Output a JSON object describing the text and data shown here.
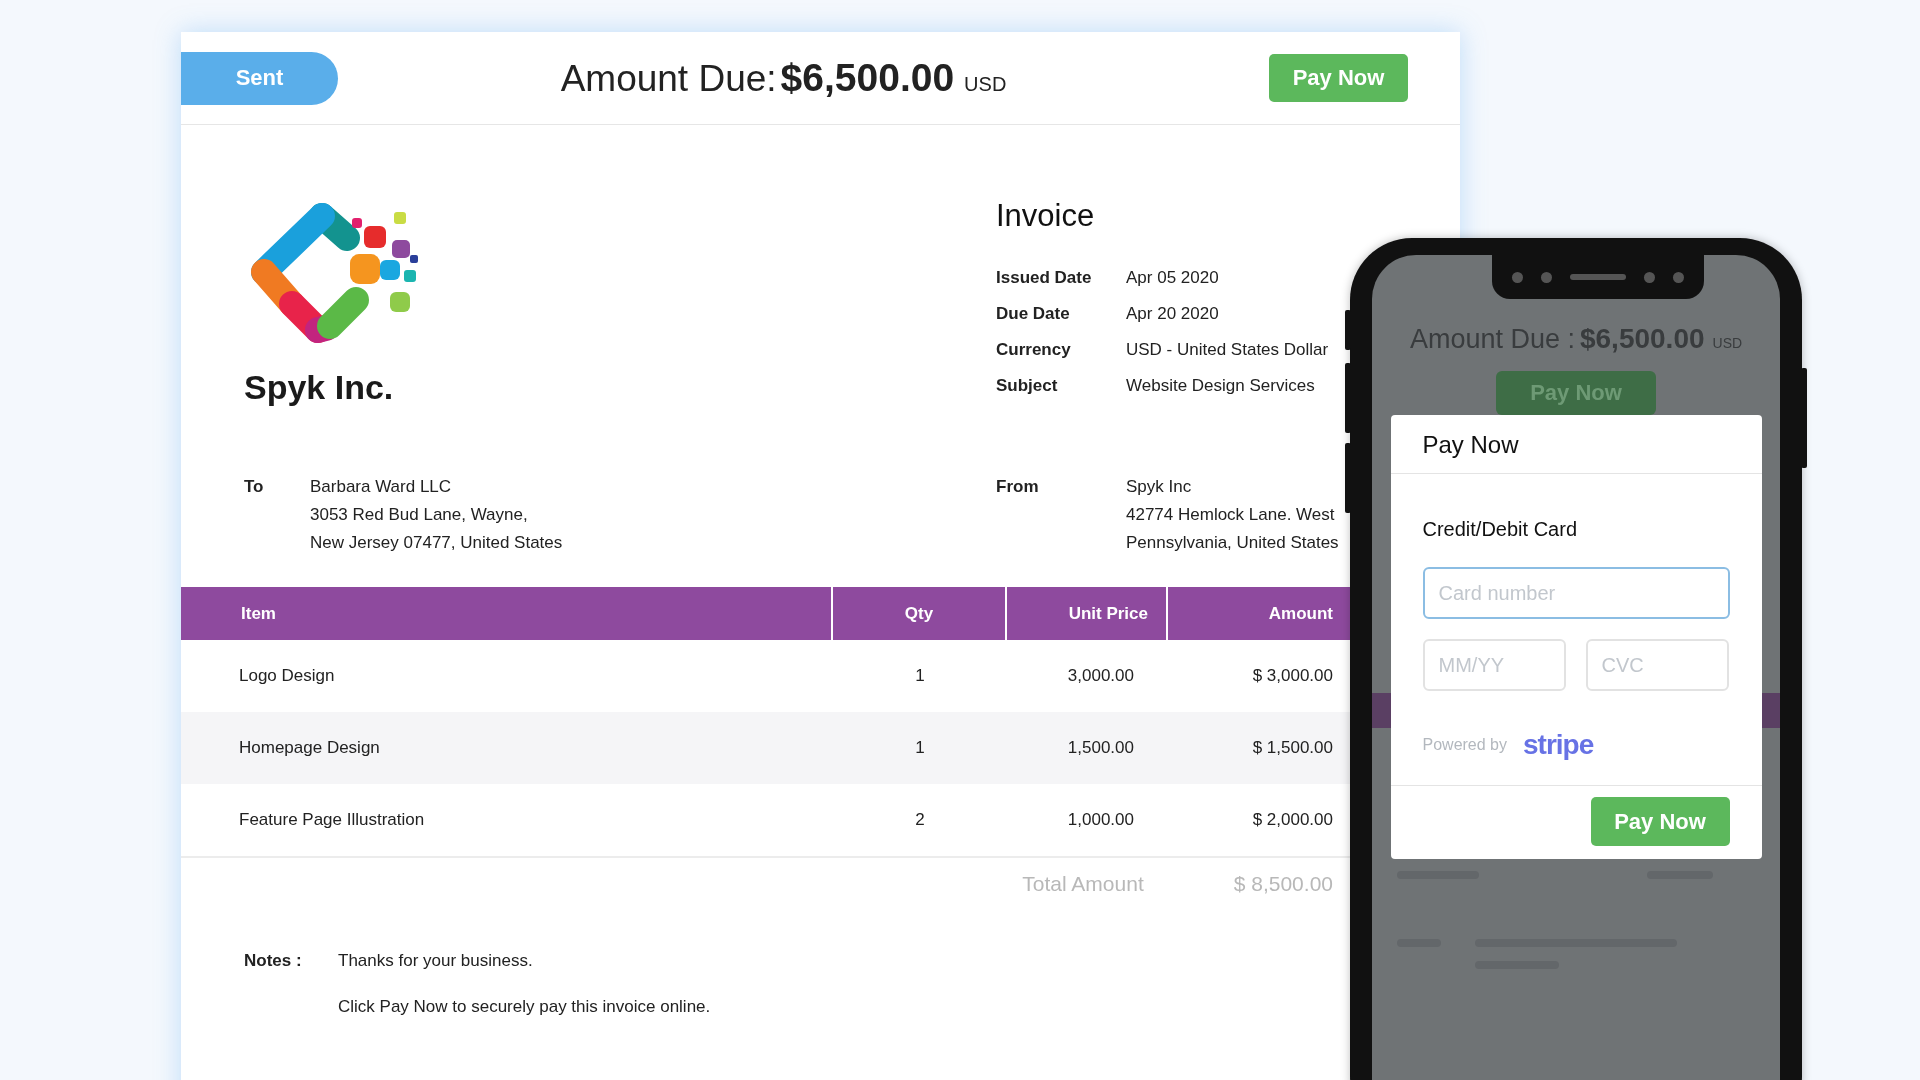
{
  "invoice": {
    "status": "Sent",
    "amount_label": "Amount Due:",
    "amount": "$6,500.00",
    "currency": "USD",
    "pay_button": "Pay Now",
    "company": "Spyk Inc.",
    "title": "Invoice",
    "details": [
      {
        "label": "Issued Date",
        "value": "Apr 05 2020"
      },
      {
        "label": "Due Date",
        "value": "Apr 20 2020"
      },
      {
        "label": "Currency",
        "value": "USD - United States Dollar"
      },
      {
        "label": "Subject",
        "value": "Website Design Services"
      }
    ],
    "to": {
      "label": "To",
      "lines": [
        "Barbara Ward LLC",
        "3053 Red Bud Lane, Wayne,",
        "New Jersey 07477, United States"
      ]
    },
    "from": {
      "label": "From",
      "lines": [
        "Spyk Inc",
        "42774 Hemlock Lane. West",
        "Pennsylvania, United States"
      ]
    },
    "table": {
      "columns": [
        "Item",
        "Qty",
        "Unit Price",
        "Amount"
      ],
      "rows": [
        {
          "item": "Logo Design",
          "qty": "1",
          "unit_price": "3,000.00",
          "amount": "$ 3,000.00"
        },
        {
          "item": "Homepage Design",
          "qty": "1",
          "unit_price": "1,500.00",
          "amount": "$ 1,500.00"
        },
        {
          "item": "Feature Page Illustration",
          "qty": "2",
          "unit_price": "1,000.00",
          "amount": "$ 2,000.00"
        }
      ]
    },
    "total": {
      "label": "Total Amount",
      "value": "$ 8,500.00"
    },
    "notes": {
      "label": "Notes :",
      "lines": [
        "Thanks for your business.",
        "Click Pay Now to securely pay this invoice online."
      ]
    }
  },
  "phone": {
    "amount_label": "Amount Due :",
    "amount": "$6,500.00",
    "currency": "USD",
    "pay_button": "Pay Now",
    "modal": {
      "title": "Pay Now",
      "section": "Credit/Debit Card",
      "card_number": {
        "placeholder": "Card number"
      },
      "expiry": {
        "placeholder": "MM/YY"
      },
      "cvc": {
        "placeholder": "CVC"
      },
      "powered_by": "Powered by",
      "brand": "stripe",
      "submit": "Pay Now"
    }
  }
}
